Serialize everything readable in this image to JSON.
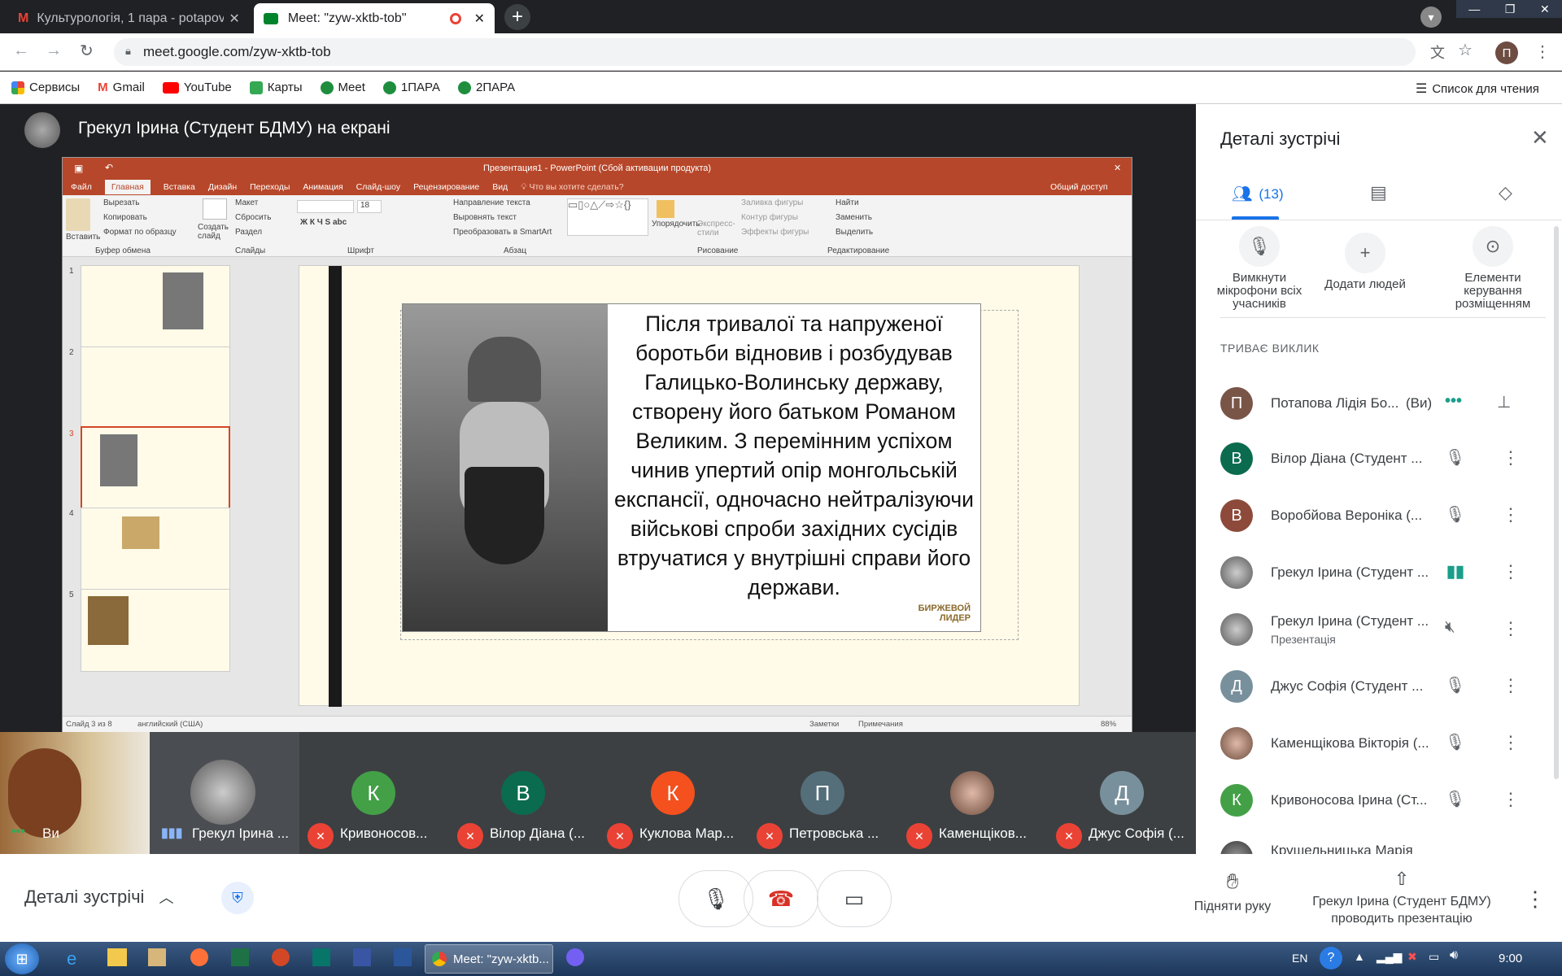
{
  "browser": {
    "tabs": [
      {
        "title": "Культурологія, 1 пара - potapov"
      },
      {
        "title": "Meet: \"zyw-xktb-tob\""
      }
    ],
    "url": "meet.google.com/zyw-xktb-tob",
    "profile_initial": "П",
    "bookmarks": [
      "Сервисы",
      "Gmail",
      "YouTube",
      "Карты",
      "Meet",
      "1ПАРА",
      "2ПАРА"
    ],
    "reading_list": "Список для чтения"
  },
  "meet": {
    "presenter_title": "Грекул Ірина (Студент БДМУ) на екрані",
    "ppt": {
      "window_title": "Презентация1 - PowerPoint (Сбой активации продукта)",
      "menu": [
        "Файл",
        "Главная",
        "Вставка",
        "Дизайн",
        "Переходы",
        "Анимация",
        "Слайд-шоу",
        "Рецензирование",
        "Вид"
      ],
      "tell_me": "Что вы хотите сделать?",
      "share": "Общий доступ",
      "ribbon_groups": [
        "Буфер обмена",
        "Слайды",
        "Шрифт",
        "Абзац",
        "Рисование",
        "Редактирование"
      ],
      "clipboard": [
        "Вырезать",
        "Копировать",
        "Формат по образцу"
      ],
      "paste": "Вставить",
      "slides": [
        "Макет",
        "Сбросить",
        "Раздел"
      ],
      "new_slide": "Создать слайд",
      "paragraph": [
        "Направление текста",
        "Выровнять текст",
        "Преобразовать в SmartArt"
      ],
      "drawing": [
        "Заливка фигуры",
        "Контур фигуры",
        "Эффекты фигуры"
      ],
      "arrange": "Упорядочить",
      "quick_styles": "Экспресс-стили",
      "editing": [
        "Найти",
        "Заменить",
        "Выделить"
      ],
      "font_size": "18",
      "thumb_numbers": [
        "1",
        "2",
        "3",
        "4",
        "5"
      ],
      "slide_text": "Після тривалої та напруженої боротьби відновив і розбудував Галицько-Волинську державу, створену його батьком Романом Великим. З перемінним успіхом чинив упертий опір монгольській експансії, одночасно нейтралізуючи військові спроби західних сусідів втручатися у внутрішні справи його держави.",
      "watermark": "БИРЖЕВОЙ ЛИДЕР",
      "status_left": "Слайд 3 из 8",
      "lang": "английский (США)",
      "notes": "Заметки",
      "comments": "Примечания",
      "zoom": "88%"
    },
    "tiles": [
      {
        "name": "Ви",
        "initial": ""
      },
      {
        "name": "Грекул Ірина ...",
        "initial": ""
      },
      {
        "name": "Кривоносов...",
        "initial": "К",
        "color": "#43a047"
      },
      {
        "name": "Вілор Діана (...",
        "initial": "В",
        "color": "#0b6b4f"
      },
      {
        "name": "Куклова Мар...",
        "initial": "К",
        "color": "#f4511e"
      },
      {
        "name": "Петровська ...",
        "initial": "П",
        "color": "#546e7a"
      },
      {
        "name": "Каменщіков...",
        "initial": ""
      },
      {
        "name": "Джус Софія (...",
        "initial": "Д",
        "color": "#78909c"
      }
    ],
    "panel": {
      "title": "Деталі зустрічі",
      "people_count": "(13)",
      "actions": [
        "Вимкнути мікрофони всіх учасників",
        "Додати людей",
        "Елементи керування розміщенням"
      ],
      "section": "ТРИВАЄ ВИКЛИК",
      "participants": [
        {
          "name": "Потапова Лідія Бо...",
          "you": "(Ви)",
          "initial": "П",
          "color": "#795548"
        },
        {
          "name": "Вілор Діана (Студент ...",
          "initial": "В",
          "color": "#0b6b4f"
        },
        {
          "name": "Воробйова Вероніка (...",
          "initial": "В",
          "color": "#8d4a3a"
        },
        {
          "name": "Грекул Ірина (Студент ...",
          "initial": ""
        },
        {
          "name": "Грекул Ірина (Студент ...",
          "sub": "Презентація",
          "initial": ""
        },
        {
          "name": "Джус Софія (Студент ...",
          "initial": "Д",
          "color": "#78909c"
        },
        {
          "name": "Каменщікова Вікторія (...",
          "initial": ""
        },
        {
          "name": "Кривоносова Ірина (Ст...",
          "initial": "К",
          "color": "#43a047"
        },
        {
          "name": "Крушельницька Марія",
          "initial": ""
        }
      ]
    },
    "bottom": {
      "details": "Деталі зустрічі",
      "raise_hand": "Підняти руку",
      "presenting_line1": "Грекул Ірина (Студент БДМУ)",
      "presenting_line2": "проводить презентацію"
    }
  },
  "taskbar": {
    "chrome_task": "Meet: \"zyw-xktb...",
    "lang": "EN",
    "time": "9:00"
  }
}
